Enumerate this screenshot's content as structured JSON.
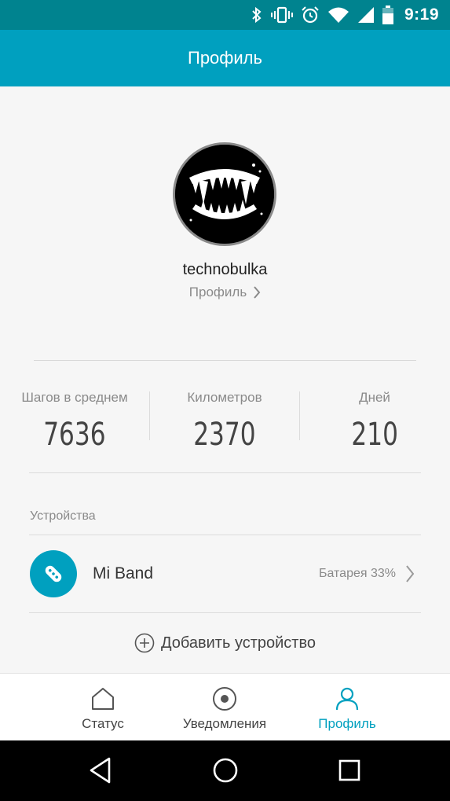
{
  "status_bar": {
    "time": "9:19",
    "icons": [
      "bluetooth-icon",
      "vibrate-icon",
      "alarm-icon",
      "wifi-icon",
      "signal-icon",
      "battery-icon"
    ]
  },
  "app_bar": {
    "title": "Профиль"
  },
  "profile": {
    "username": "technobulka",
    "link_label": "Профиль"
  },
  "stats": [
    {
      "label": "Шагов в среднем",
      "value": "7636"
    },
    {
      "label": "Километров",
      "value": "2370"
    },
    {
      "label": "Дней",
      "value": "210"
    }
  ],
  "devices": {
    "header": "Устройства",
    "items": [
      {
        "name": "Mi Band",
        "battery": "Батарея 33%"
      }
    ],
    "add_label": "Добавить устройство"
  },
  "bottom_nav": {
    "tabs": [
      {
        "label": "Статус",
        "icon": "home-icon",
        "active": false
      },
      {
        "label": "Уведомления",
        "icon": "notification-circle-icon",
        "active": false
      },
      {
        "label": "Профиль",
        "icon": "person-icon",
        "active": true
      }
    ]
  },
  "colors": {
    "status_bar": "#00838f",
    "app_bar": "#00a0bf",
    "accent": "#00a0bf",
    "background": "#f6f6f6"
  }
}
